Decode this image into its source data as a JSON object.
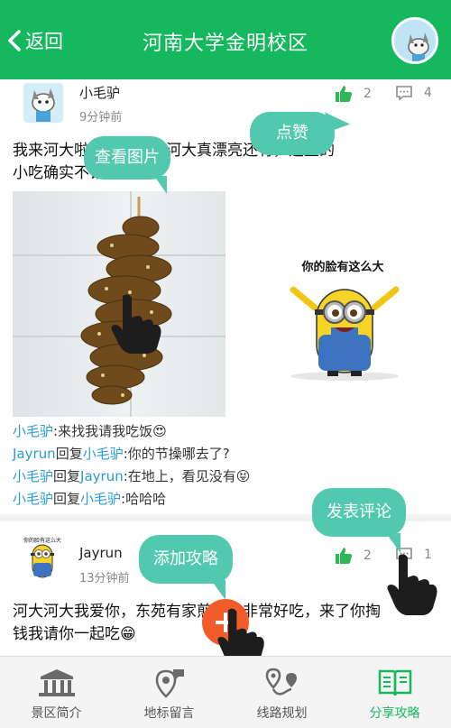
{
  "header": {
    "back_label": "返回",
    "title": "河南大学金明校区"
  },
  "posts": [
    {
      "username": "小毛驴",
      "time": "9分钟前",
      "likes": "2",
      "comments": "4",
      "text_line1": "我来河大啦，欢迎我！河大真漂亮还有，这里的",
      "text_line2": "小吃确实不错",
      "sticker_caption": "你的脸有这么大",
      "comment_list": [
        {
          "user": "小毛驴",
          "text": ":来找我请我吃饭",
          "emoji": "😍"
        },
        {
          "user": "Jayrun",
          "reply": "回复",
          "target": "小毛驴",
          "text": ":你的节操哪去了?"
        },
        {
          "user": "小毛驴",
          "reply": "回复",
          "target": "Jayrun",
          "text": ":在地上，看见没有",
          "emoji": "😝"
        },
        {
          "user": "小毛驴",
          "reply": "回复",
          "target": "小毛驴",
          "text": ":哈哈哈"
        }
      ]
    },
    {
      "username": "Jayrun",
      "time": "13分钟前",
      "likes": "2",
      "comments": "1",
      "text_line1": "河大河大我爱你，东苑有家煎饼子非常好吃，来了你掏",
      "text_line2": "钱我请你一起吃",
      "emoji": "😁"
    }
  ],
  "tooltips": {
    "like": "点赞",
    "view_image": "查看图片",
    "comment": "发表评论",
    "add_guide": "添加攻略"
  },
  "bottom_nav": [
    {
      "label": "景区简介",
      "icon": "scenic-building-icon"
    },
    {
      "label": "地标留言",
      "icon": "landmark-pin-icon"
    },
    {
      "label": "线路规划",
      "icon": "route-icon"
    },
    {
      "label": "分享攻略",
      "icon": "share-book-icon",
      "active": true
    }
  ],
  "colors": {
    "brand_green": "#16b85e",
    "tooltip_teal": "#52c9ae",
    "fab_orange": "#f25b2a",
    "link_blue": "#2a9bd6"
  }
}
